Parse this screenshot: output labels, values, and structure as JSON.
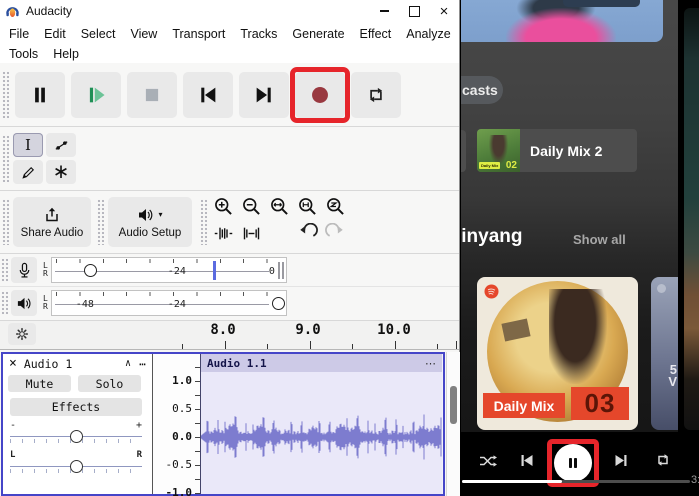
{
  "audacity": {
    "title": "Audacity",
    "menus": [
      "File",
      "Edit",
      "Select",
      "View",
      "Transport",
      "Tracks",
      "Generate",
      "Effect",
      "Analyze",
      "Tools",
      "Help"
    ],
    "buttons": {
      "share_audio": "Share Audio",
      "audio_setup": "Audio Setup"
    },
    "meters": {
      "recording": {
        "channels": [
          "L",
          "R"
        ],
        "labels": [
          "-24",
          "0"
        ]
      },
      "playback": {
        "channels": [
          "L",
          "R"
        ],
        "labels": [
          "-48",
          "-24"
        ]
      }
    },
    "timeline": {
      "ticks": [
        "8.0",
        "9.0",
        "10.0"
      ]
    },
    "track": {
      "name": "Audio 1",
      "mute": "Mute",
      "solo": "Solo",
      "effects": "Effects",
      "gain_min": "-",
      "gain_max": "+",
      "pan_left": "L",
      "pan_right": "R",
      "ruler": [
        "1.0",
        "0.5",
        "0.0",
        "-0.5",
        "-1.0"
      ],
      "clip_name": "Audio 1.1"
    },
    "icons": {
      "close": "×",
      "collapse": "∧",
      "menu_dots": "⋯",
      "selection_tool": "I",
      "multi_tool": "∗"
    }
  },
  "spotify": {
    "chip": "casts",
    "daily_mix2": {
      "title": "Daily Mix 2",
      "badge": "Daily Mix",
      "number": "02"
    },
    "section": {
      "title": "linyang",
      "show_all": "Show all"
    },
    "daily_mix3": {
      "badge": "Daily Mix",
      "number": "03"
    },
    "partial_card_text": "5V",
    "player": {
      "time": "3:"
    }
  },
  "colors": {
    "highlight_red": "#e6252b",
    "record_red": "#993940",
    "waveform": "#7d7ccf",
    "track_border": "#4545c8",
    "daily_mix_red": "#e5472b",
    "badge_yellow": "#dfee44"
  }
}
